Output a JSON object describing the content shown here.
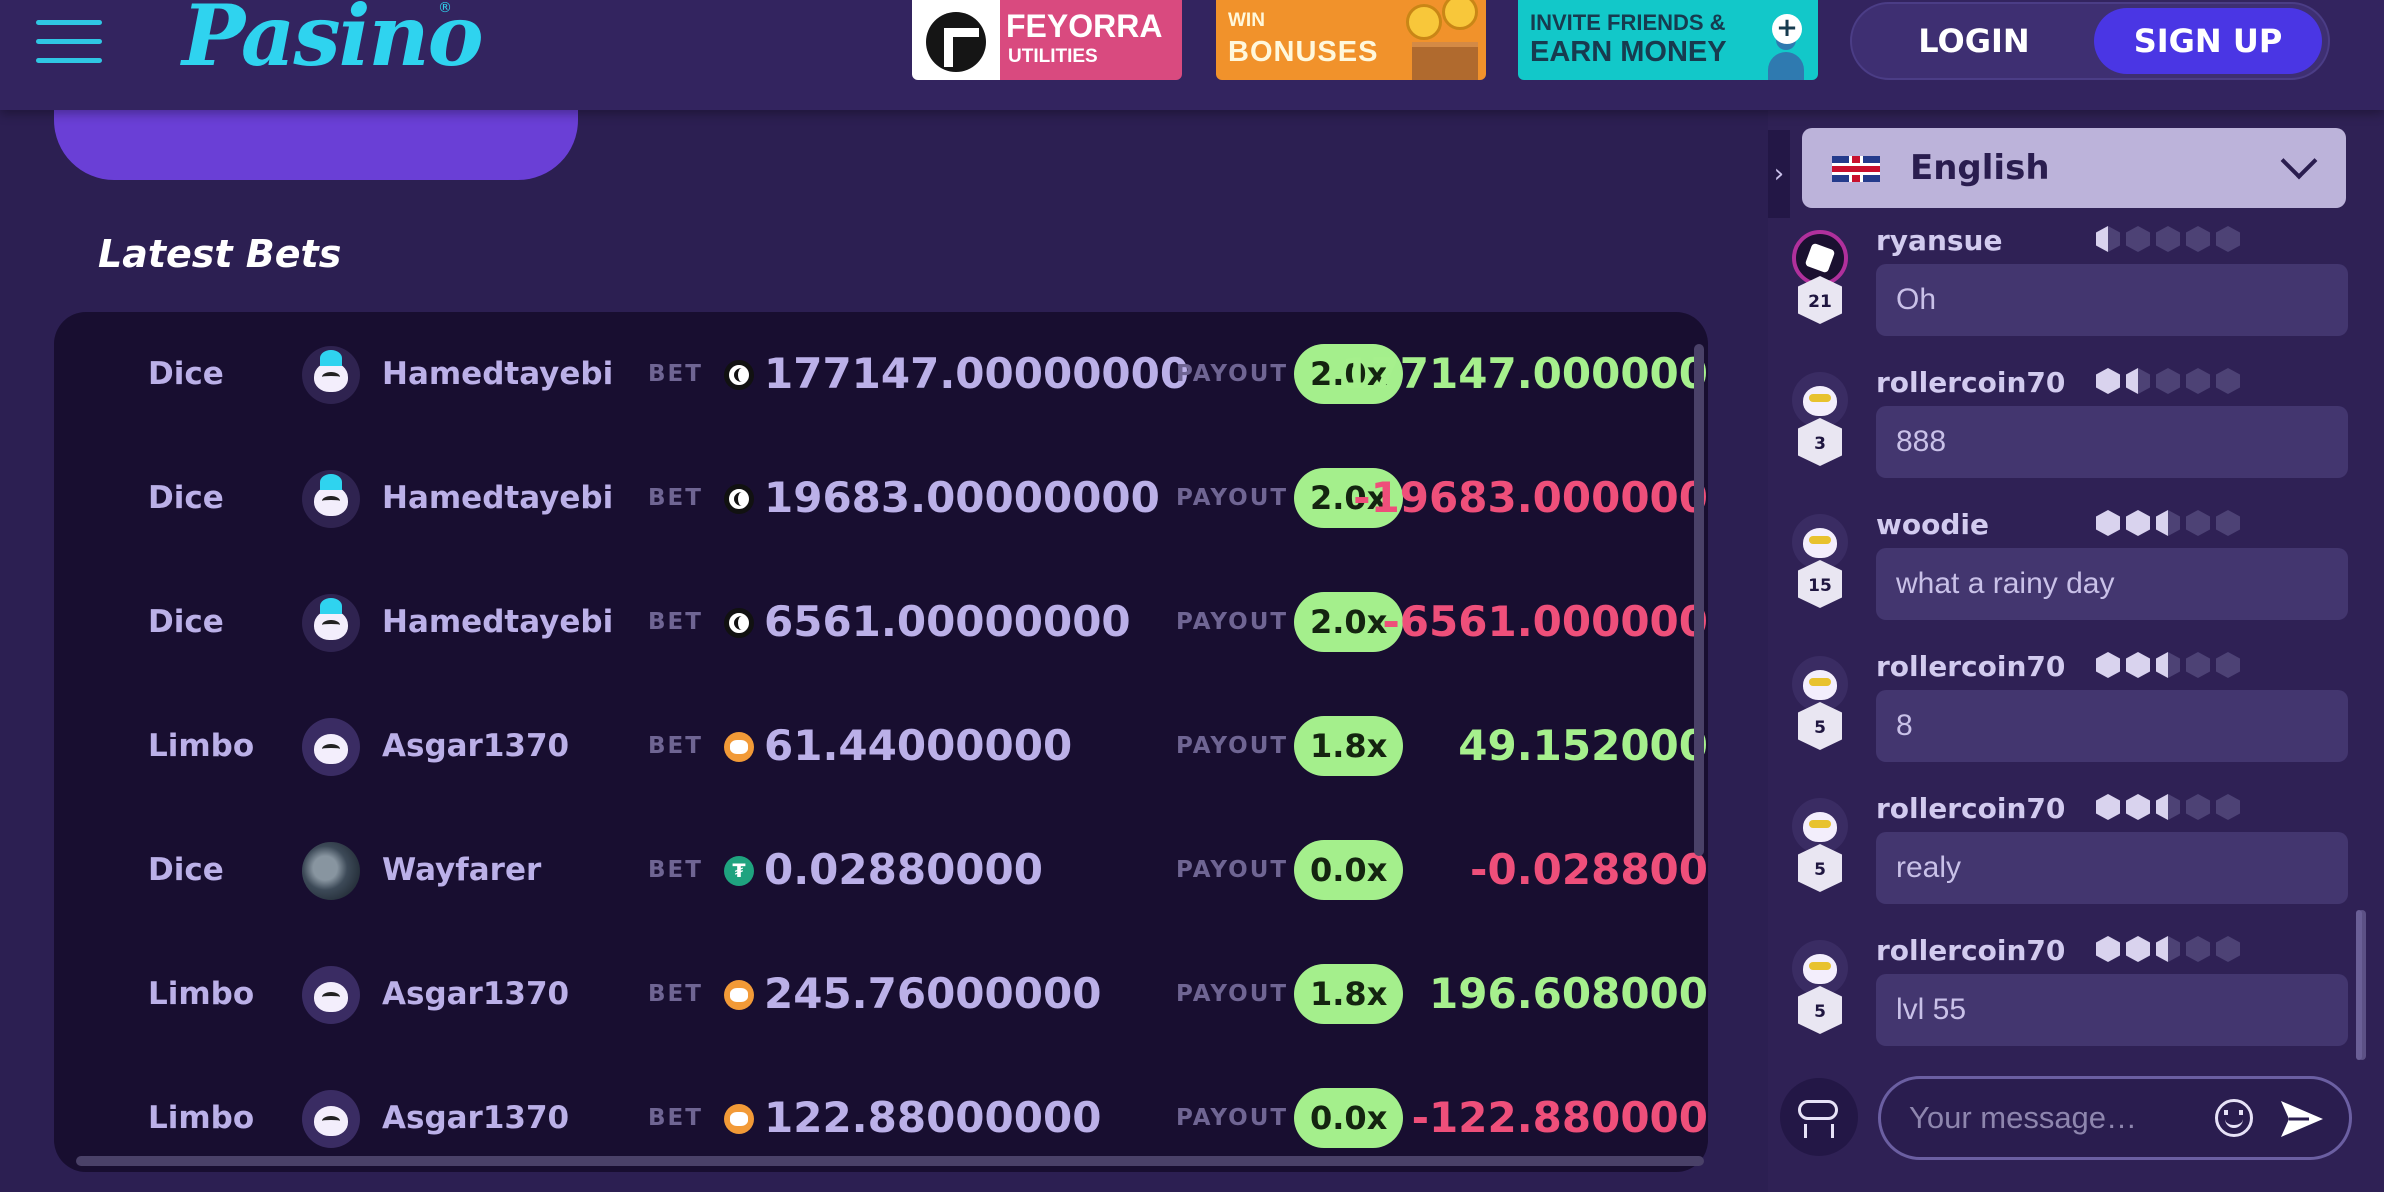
{
  "header": {
    "logo": "Pasino",
    "logo_mark": "®",
    "banners": {
      "feyorra": {
        "title": "FEYORRA",
        "subtitle": "UTILITIES"
      },
      "win": {
        "small": "WIN",
        "big": "BONUSES"
      },
      "invite": {
        "line1": "INVITE FRIENDS &",
        "line2": "EARN MONEY",
        "plus": "+"
      }
    },
    "login_label": "LOGIN",
    "signup_label": "SIGN UP"
  },
  "main": {
    "section_title": "Latest Bets",
    "bet_label": "BET",
    "payout_label": "PAYOUT",
    "bets": [
      {
        "game": "Dice",
        "user": "Hamedtayebi",
        "coin": "moon-coin-icon",
        "bet": "177147.00000000",
        "multiplier": "2.0x",
        "payout": "177147.000000",
        "result": "win"
      },
      {
        "game": "Dice",
        "user": "Hamedtayebi",
        "coin": "moon-coin-icon",
        "bet": "19683.00000000",
        "multiplier": "2.0x",
        "payout": "-19683.000000",
        "result": "loss"
      },
      {
        "game": "Dice",
        "user": "Hamedtayebi",
        "coin": "moon-coin-icon",
        "bet": "6561.00000000",
        "multiplier": "2.0x",
        "payout": "-6561.000000",
        "result": "loss"
      },
      {
        "game": "Limbo",
        "user": "Asgar1370",
        "coin": "bull-coin-icon",
        "bet": "61.44000000",
        "multiplier": "1.8x",
        "payout": "49.152000",
        "result": "win"
      },
      {
        "game": "Dice",
        "user": "Wayfarer",
        "coin": "tether-coin-icon",
        "bet": "0.02880000",
        "multiplier": "0.0x",
        "payout": "-0.028800",
        "result": "loss"
      },
      {
        "game": "Limbo",
        "user": "Asgar1370",
        "coin": "bull-coin-icon",
        "bet": "245.76000000",
        "multiplier": "1.8x",
        "payout": "196.608000",
        "result": "win"
      },
      {
        "game": "Limbo",
        "user": "Asgar1370",
        "coin": "bull-coin-icon",
        "bet": "122.88000000",
        "multiplier": "0.0x",
        "payout": "-122.880000",
        "result": "loss"
      }
    ]
  },
  "chat": {
    "language": "English",
    "messages": [
      {
        "user": "ryansue",
        "level": "21",
        "text": "Oh",
        "stars": [
          "half",
          "empty",
          "empty",
          "empty",
          "empty"
        ]
      },
      {
        "user": "rollercoin70",
        "level": "3",
        "text": "888",
        "stars": [
          "full",
          "half",
          "empty",
          "empty",
          "empty"
        ]
      },
      {
        "user": "woodie",
        "level": "15",
        "text": "what a rainy day",
        "stars": [
          "full",
          "full",
          "half",
          "empty",
          "empty"
        ]
      },
      {
        "user": "rollercoin70",
        "level": "5",
        "text": "8",
        "stars": [
          "full",
          "full",
          "half",
          "empty",
          "empty"
        ]
      },
      {
        "user": "rollercoin70",
        "level": "5",
        "text": "realy",
        "stars": [
          "full",
          "full",
          "half",
          "empty",
          "empty"
        ]
      },
      {
        "user": "rollercoin70",
        "level": "5",
        "text": "lvl 55",
        "stars": [
          "full",
          "full",
          "half",
          "empty",
          "empty"
        ]
      }
    ],
    "input_placeholder": "Your message…"
  },
  "colors": {
    "background": "#2c1f52",
    "accent": "#4a36e4",
    "win": "#a6f08d",
    "loss": "#ee4f7a",
    "logo": "#2fd3ef"
  }
}
